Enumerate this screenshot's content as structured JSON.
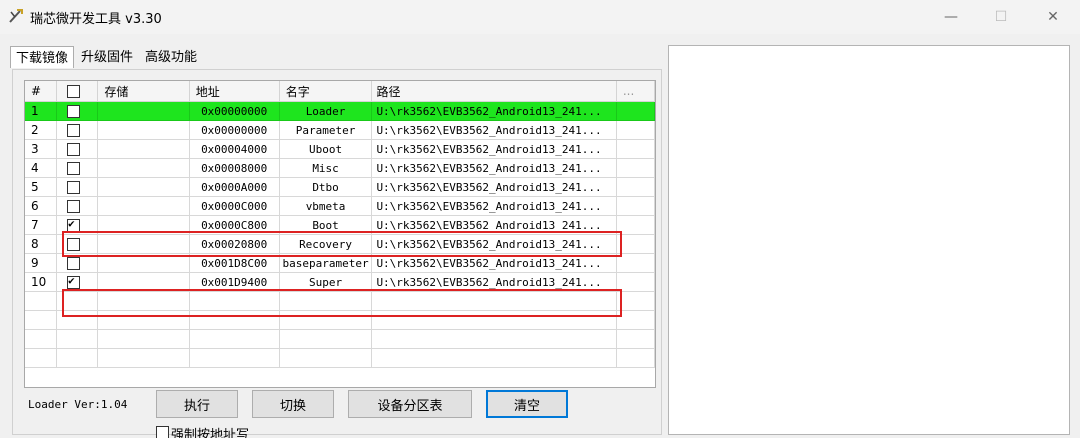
{
  "window": {
    "title": "瑞芯微开发工具 v3.30",
    "min_icon": "—",
    "max_icon": "☐",
    "close_icon": "✕"
  },
  "tabs": [
    {
      "label": "下载镜像",
      "active": true
    },
    {
      "label": "升级固件",
      "active": false
    },
    {
      "label": "高级功能",
      "active": false
    }
  ],
  "table": {
    "headers": {
      "num": "#",
      "storage": "存储",
      "address": "地址",
      "name": "名字",
      "path": "路径",
      "more": "..."
    },
    "rows": [
      {
        "num": "1",
        "checked": false,
        "address": "0x00000000",
        "name": "Loader",
        "path": "U:\\rk3562\\EVB3562_Android13_241...",
        "highlight": true
      },
      {
        "num": "2",
        "checked": false,
        "address": "0x00000000",
        "name": "Parameter",
        "path": "U:\\rk3562\\EVB3562_Android13_241..."
      },
      {
        "num": "3",
        "checked": false,
        "address": "0x00004000",
        "name": "Uboot",
        "path": "U:\\rk3562\\EVB3562_Android13_241..."
      },
      {
        "num": "4",
        "checked": false,
        "address": "0x00008000",
        "name": "Misc",
        "path": "U:\\rk3562\\EVB3562_Android13_241..."
      },
      {
        "num": "5",
        "checked": false,
        "address": "0x0000A000",
        "name": "Dtbo",
        "path": "U:\\rk3562\\EVB3562_Android13_241..."
      },
      {
        "num": "6",
        "checked": false,
        "address": "0x0000C000",
        "name": "vbmeta",
        "path": "U:\\rk3562\\EVB3562_Android13_241..."
      },
      {
        "num": "7",
        "checked": true,
        "address": "0x0000C800",
        "name": "Boot",
        "path": "U:\\rk3562\\EVB3562_Android13_241..."
      },
      {
        "num": "8",
        "checked": false,
        "address": "0x00020800",
        "name": "Recovery",
        "path": "U:\\rk3562\\EVB3562_Android13_241..."
      },
      {
        "num": "9",
        "checked": false,
        "address": "0x001D8C00",
        "name": "baseparameter",
        "path": "U:\\rk3562\\EVB3562_Android13_241..."
      },
      {
        "num": "10",
        "checked": true,
        "address": "0x001D9400",
        "name": "Super",
        "path": "U:\\rk3562\\EVB3562_Android13_241...",
        "storage_box": true
      }
    ]
  },
  "loader_ver": "Loader Ver:1.04",
  "buttons": {
    "execute": "执行",
    "switch": "切换",
    "partition_table": "设备分区表",
    "clear": "清空"
  },
  "force_check_label": "强制按地址写"
}
